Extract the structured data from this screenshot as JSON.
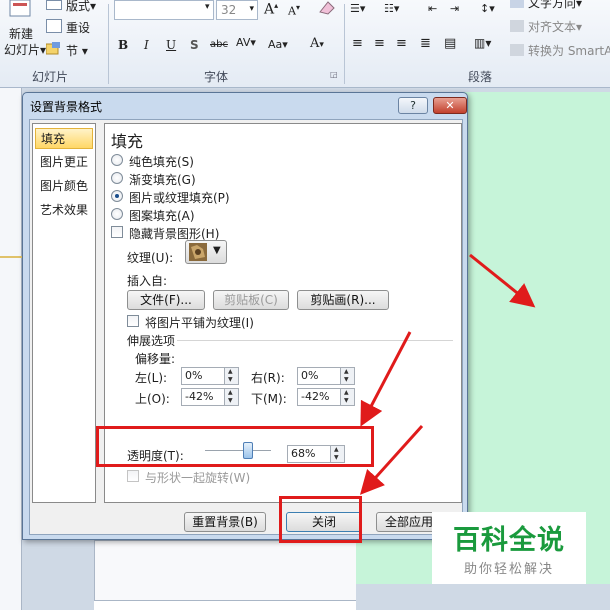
{
  "ribbon": {
    "new_slide_label": "新建\n幻灯片",
    "layout_label": "版式",
    "reset_label": "重设",
    "section_label": "节",
    "font_size": "32",
    "group_slides": "幻灯片",
    "group_font": "字体",
    "group_paragraph": "段落",
    "text_direction": "文字方向",
    "align_text": "对齐文本",
    "convert_smartart": "转换为 SmartA"
  },
  "dialog": {
    "title": "设置背景格式",
    "help_label": "?",
    "close_x_label": "✕",
    "nav": [
      {
        "label": "填充"
      },
      {
        "label": "图片更正"
      },
      {
        "label": "图片颜色"
      },
      {
        "label": "艺术效果"
      }
    ],
    "section_title": "填充",
    "fill_options": [
      {
        "label": "纯色填充(S)"
      },
      {
        "label": "渐变填充(G)"
      },
      {
        "label": "图片或纹理填充(P)"
      },
      {
        "label": "图案填充(A)"
      }
    ],
    "hide_bg_label": "隐藏背景图形(H)",
    "texture_label": "纹理(U):",
    "insert_from_label": "插入自:",
    "file_button": "文件(F)...",
    "clipboard_button": "剪贴板(C)",
    "clipart_button": "剪贴画(R)...",
    "tile_label": "将图片平铺为纹理(I)",
    "stretch_options_label": "伸展选项",
    "offset_label": "偏移量:",
    "offsets": {
      "left_label": "左(L):",
      "left_value": "0%",
      "right_label": "右(R):",
      "right_value": "0%",
      "top_label": "上(O):",
      "top_value": "-42%",
      "bottom_label": "下(M):",
      "bottom_value": "-42%"
    },
    "transparency_label": "透明度(T):",
    "transparency_value": "68%",
    "transparency_level": 0.68,
    "rotate_with_shape_label": "与形状一起旋转(W)",
    "reset_bg_button": "重置背景(B)",
    "close_button": "关闭",
    "apply_all_button": "全部应用(L)"
  },
  "watermark": {
    "title": "百科全说",
    "subtitle": "助你轻松解决"
  },
  "colors": {
    "slide_bg": "#c6f4d9",
    "annotation_red": "#e01b1b",
    "watermark_green": "#1a9a3d"
  }
}
